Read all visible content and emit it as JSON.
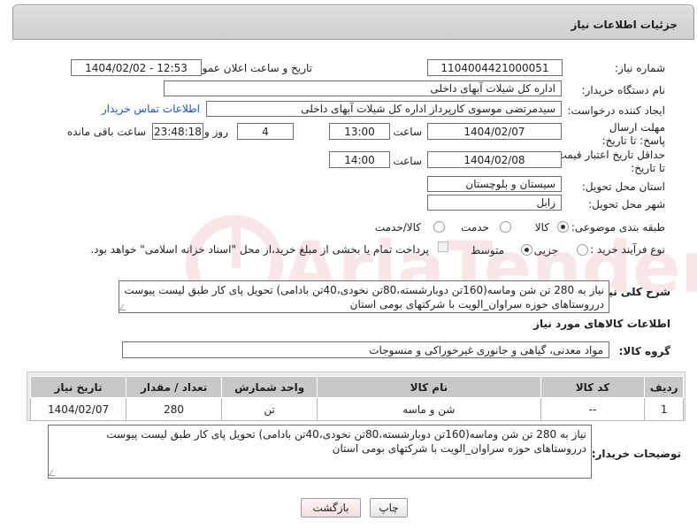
{
  "header": {
    "title": "جزئیات اطلاعات نیاز"
  },
  "fields": {
    "need_number": {
      "label": "شماره نیاز:",
      "value": "1104004421000051"
    },
    "announce_datetime": {
      "label": "تاریخ و ساعت اعلان عمومی:",
      "value": "1404/02/02 - 12:53"
    },
    "buyer_org": {
      "label": "نام دستگاه خریدار:",
      "value": "اداره کل شیلات آبهای داخلی"
    },
    "requester": {
      "label": "ایجاد کننده درخواست:",
      "value": "سیدمرتضی موسوی کارپرداز اداره کل شیلات آبهای داخلی",
      "contact_link": "اطلاعات تماس خریدار"
    },
    "reply_deadline": {
      "label": "مهلت ارسال پاسخ: تا تاریخ:",
      "date": "1404/02/07",
      "time_label": "ساعت",
      "time": "13:00",
      "days": "4",
      "days_label": "روز و",
      "remaining": "23:48:18",
      "remaining_label": "ساعت باقی مانده"
    },
    "price_validity": {
      "label": "حداقل تاریخ اعتبار قیمت: تا تاریخ:",
      "date": "1404/02/08",
      "time_label": "ساعت",
      "time": "14:00"
    },
    "delivery_province": {
      "label": "استان محل تحویل:",
      "value": "سیستان و بلوچستان"
    },
    "delivery_city": {
      "label": "شهر محل تحویل:",
      "value": "زابل"
    },
    "category": {
      "label": "طبقه بندی موضوعی:",
      "options": [
        "کالا",
        "خدمت",
        "کالا/خدمت"
      ],
      "selected": "کالا"
    },
    "purchase_process": {
      "label": "نوع فرآیند خرید :",
      "options": [
        "جزیی",
        "متوسط"
      ],
      "selected": "متوسط",
      "payment_note": "پرداخت تمام یا بخشی از مبلغ خرید،از محل \"اسناد خزانه اسلامی\" خواهد بود."
    }
  },
  "general_description": {
    "label": "شرح کلی نیاز:",
    "text": "نیاز به 280 تن شن وماسه(160تن دوبارشسته،80تن نخودی،40تن بادامی) تحویل پای کار طبق لیست پیوست درروستاهای حوزه سراوان_الویت با شرکتهای بومی استان"
  },
  "goods_section": {
    "title": "اطلاعات کالاهای مورد نیاز"
  },
  "goods_group": {
    "label": "گروه کالا:",
    "value": "مواد معدنی، گیاهی و جانوری غیرخوراکی و منسوجات"
  },
  "table": {
    "headers": [
      "ردیف",
      "کد کالا",
      "نام کالا",
      "واحد شمارش",
      "تعداد / مقدار",
      "تاریخ نیاز"
    ],
    "rows": [
      [
        "1",
        "--",
        "شن و ماسه",
        "تن",
        "280",
        "1404/02/07"
      ]
    ]
  },
  "buyer_notes": {
    "label": "توضیحات خریدار:",
    "text": "نیاز به 280 تن شن وماسه(160تن دوبارشسته،80تن نخودی،40تن بادامی) تحویل پای کار طبق لیست پیوست درروستاهای حوزه سراوان_الویت با شرکتهای بومی استان"
  },
  "buttons": {
    "print": "چاپ",
    "back": "بازگشت"
  },
  "colors": {
    "link": "#1a55c4",
    "header_bg": "#d6d6d6",
    "back_button_bg": "#f6dede"
  },
  "watermark": {
    "text": "AriaTender.neT"
  }
}
